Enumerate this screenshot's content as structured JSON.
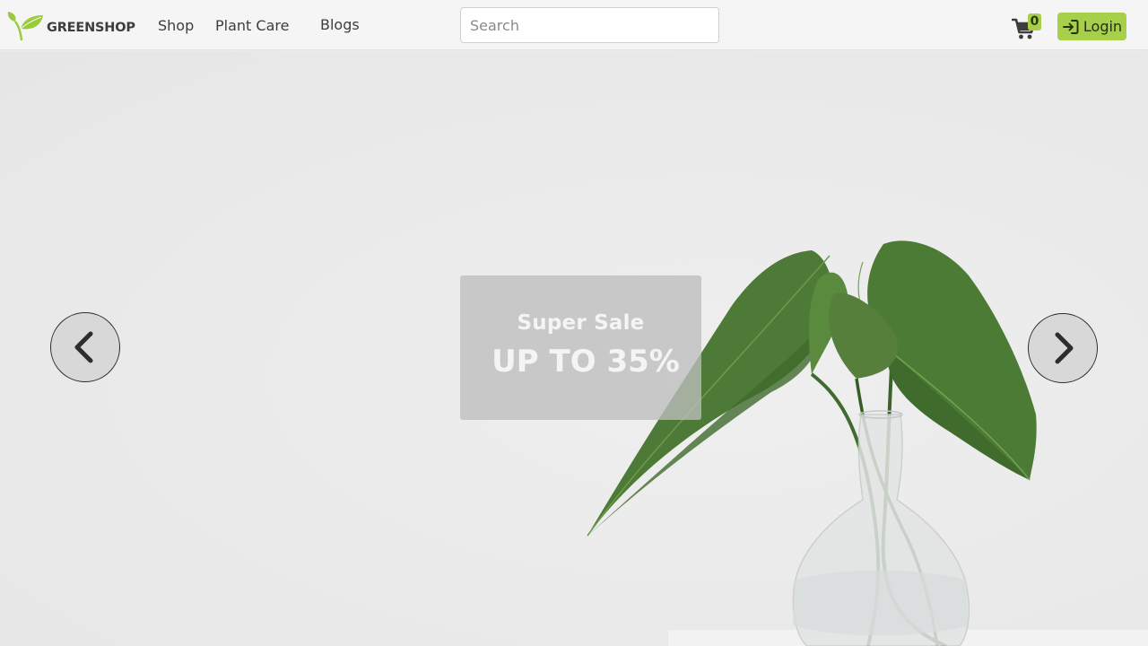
{
  "brand": {
    "name": "GREENSHOP",
    "logo_icon": "leaf-icon",
    "accent": "#a6cf4a"
  },
  "nav": {
    "links": [
      {
        "label": "Shop"
      },
      {
        "label": "Plant Care"
      },
      {
        "label": "Blogs"
      }
    ]
  },
  "search": {
    "placeholder": "Search",
    "value": ""
  },
  "cart": {
    "icon": "cart-icon",
    "count": "0"
  },
  "login": {
    "label": "Login",
    "icon": "login-icon"
  },
  "hero": {
    "sale_title": "Super Sale",
    "sale_discount": "UP TO 35%",
    "prev_icon": "chevron-left-icon",
    "next_icon": "chevron-right-icon",
    "image_subject": "plant-in-glass-vase"
  }
}
